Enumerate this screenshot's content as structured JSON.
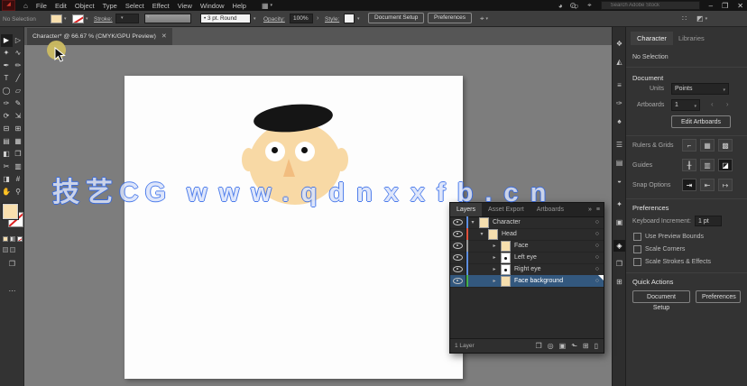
{
  "app": {
    "menu": [
      "File",
      "Edit",
      "Object",
      "Type",
      "Select",
      "Effect",
      "View",
      "Window",
      "Help"
    ],
    "search_value": "Search Adobe Stock"
  },
  "icons": {
    "home": "⌂",
    "workspace_grid": "▦",
    "share": "◕",
    "arrange": "▭",
    "pin": "⌖",
    "minimize": "–",
    "restore": "❐",
    "close": "✕",
    "tab_close": "✕",
    "double_chevron": "»",
    "panel_menu": "≡",
    "touch_cursor": "⌖",
    "grid_dots": "∷",
    "switch_workspace": "◩"
  },
  "control_bar": {
    "no_selection": "No Selection",
    "stroke_label": "Stroke:",
    "brush_value": "• 3 pt. Round",
    "opacity_label": "Opacity:",
    "opacity_value": "100%",
    "opacity_more": "›",
    "style_label": "Style:",
    "document_setup_button": "Document Setup",
    "preferences_button": "Preferences"
  },
  "document_tab": {
    "title": "Character* @ 66.67 % (CMYK/GPU Preview)"
  },
  "toolbar": {
    "tools": [
      "▶",
      "▷",
      "✦",
      "∿",
      "✒",
      "✏",
      "T",
      "╱",
      "◯",
      "▱",
      "✑",
      "✎",
      "⟳",
      "⇲",
      "⊟",
      "⊞",
      "▤",
      "▦",
      "◧",
      "❐",
      "✂",
      "▥",
      "◨",
      "#",
      "✋",
      "⚲"
    ],
    "more": "⋯"
  },
  "watermark": {
    "cjk": "技艺CG",
    "url": "www.qdnxxfb.cn",
    "outline_color": "#2e66e8"
  },
  "dock_icons": [
    "❖",
    "◭",
    "≡",
    "✑",
    "♠",
    "☰",
    "▤",
    "◒",
    "✦",
    "▣",
    "◈",
    "❐",
    "⊞"
  ],
  "layers_panel": {
    "tabs": [
      "Layers",
      "Asset Export",
      "Artboards"
    ],
    "rows": [
      {
        "name": "Character"
      },
      {
        "name": "Head"
      },
      {
        "name": "Face"
      },
      {
        "name": "Left eye"
      },
      {
        "name": "Right eye"
      },
      {
        "name": "Face background"
      }
    ],
    "footer_icons": [
      "❐",
      "◎",
      "▣",
      "⬑",
      "⊞",
      "▯"
    ],
    "status": "1 Layer"
  },
  "properties_panel": {
    "tabs": [
      "Character",
      "Libraries"
    ],
    "no_selection": "No Selection",
    "document_section": "Document",
    "units_label": "Units",
    "units_value": "Points",
    "artboards_label": "Artboards",
    "artboards_value": "1",
    "artboard_nav": "‹ ›",
    "edit_artboards_button": "Edit Artboards",
    "rulers_label": "Rulers & Grids",
    "ruler_icons": [
      "⌐",
      "▦",
      "▩"
    ],
    "guides_label": "Guides",
    "guide_icons": [
      "╂",
      "▥",
      "◪"
    ],
    "snap_label": "Snap Options",
    "snap_icons": [
      "⇥",
      "⇤",
      "↦"
    ],
    "preferences_section": "Preferences",
    "keyboard_increment_label": "Keyboard Increment:",
    "keyboard_increment_value": "1 pt",
    "checkboxes": [
      "Use Preview Bounds",
      "Scale Corners",
      "Scale Strokes & Effects"
    ],
    "quick_actions_section": "Quick Actions",
    "document_setup_button": "Document Setup",
    "preferences_button": "Preferences"
  },
  "artwork": {
    "skin_color": "#f8d9a5",
    "hat_color": "#151515",
    "nose_color": "#f2bd7f",
    "eye_color": "#ffffff",
    "pupil_color": "#111111"
  }
}
